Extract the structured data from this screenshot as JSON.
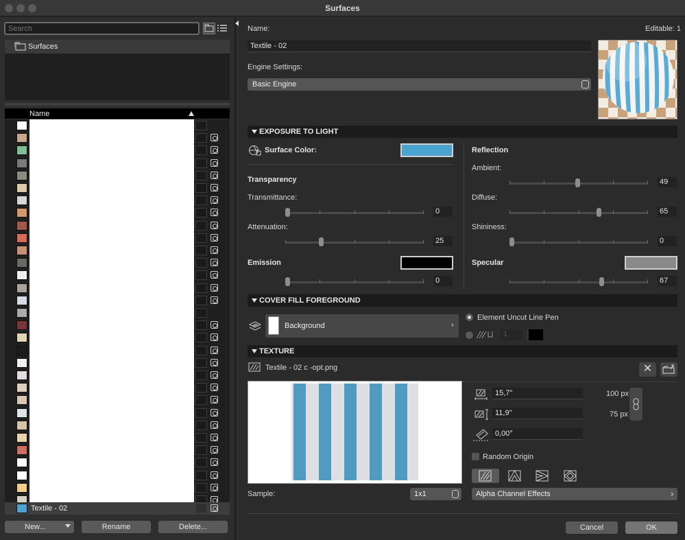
{
  "window": {
    "title": "Surfaces"
  },
  "left": {
    "search_placeholder": "Search",
    "tree_root": "Surfaces",
    "list_header": "Name",
    "selected_item": "Textile - 02",
    "swatches": [
      "#ffffff",
      "#c9a58c",
      "#7dbf96",
      "#7a7a7a",
      "#8a8d7e",
      "#dccbaa",
      "#d6d6d6",
      "#d4976e",
      "#a05a4a",
      "#d86b55",
      "#c99078",
      "#6a6a64",
      "#ededed",
      "#a8a29a",
      "#d8dbe3",
      "#aaaaaa",
      "#7a3538",
      "#e2d5b6",
      "#1c1c1c",
      "#f0f0f0",
      "#e2dbe2",
      "#ddd0bf",
      "#d9c7b3",
      "#e0e3e6",
      "#d7c3a6",
      "#e9d3aa",
      "#cd6e64",
      "#ffffff",
      "#ffffff",
      "#f3cf86",
      "#d8d0c5"
    ],
    "selected_swatch": "#4aa3cf",
    "new_label": "New...",
    "rename_label": "Rename",
    "delete_label": "Delete..."
  },
  "right": {
    "name_label": "Name:",
    "editable_label": "Editable: 1",
    "name_value": "Textile - 02",
    "engine_label": "Engine Settings:",
    "engine_value": "Basic Engine",
    "exposure": {
      "title": "EXPOSURE TO LIGHT",
      "surface_color_label": "Surface Color:",
      "surface_color": "#4aa3cf",
      "transparency_label": "Transparency",
      "transmittance_label": "Transmittance:",
      "transmittance_value": "0",
      "transmittance": 0,
      "attenuation_label": "Attenuation:",
      "attenuation_value": "25",
      "attenuation": 25,
      "emission_label": "Emission",
      "emission_color": "#000000",
      "emission_value": "0",
      "emission": 0,
      "reflection_label": "Reflection",
      "ambient_label": "Ambient:",
      "ambient_value": "49",
      "ambient": 49,
      "diffuse_label": "Diffuse:",
      "diffuse_value": "65",
      "diffuse": 65,
      "shininess_label": "Shininess:",
      "shininess_value": "0",
      "shininess": 0,
      "specular_label": "Specular",
      "specular_color": "#8a8a8a",
      "specular_value": "67",
      "specular": 67
    },
    "cover": {
      "title": "COVER FILL FOREGROUND",
      "fill_label": "Background",
      "pen_label": "Element Uncut Line Pen",
      "pen_number": "1"
    },
    "texture": {
      "title": "TEXTURE",
      "file_name": "Textile - 02 c -opt.png",
      "width_value": "15,7\"",
      "width_px": "100 px",
      "height_value": "11,9\"",
      "height_px": "75 px",
      "angle_value": "0,00°",
      "random_origin_label": "Random Origin",
      "sample_label": "Sample:",
      "sample_value": "1x1",
      "alpha_label": "Alpha Channel Effects",
      "stripe_color": "#4f9bc2"
    },
    "cancel_label": "Cancel",
    "ok_label": "OK"
  }
}
